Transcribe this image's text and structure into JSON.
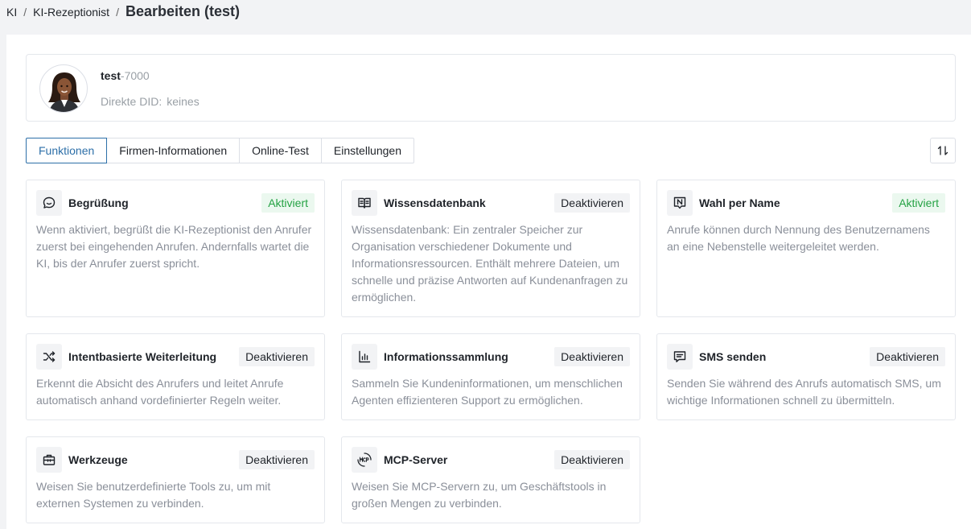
{
  "breadcrumb": {
    "items": [
      "KI",
      "KI-Rezeptionist"
    ],
    "separator": "/",
    "current": "Bearbeiten (test)"
  },
  "agent": {
    "name": "test",
    "extension": "-7000",
    "did_label": "Direkte DID:",
    "did_value": "keines"
  },
  "tabs": [
    {
      "label": "Funktionen",
      "active": true
    },
    {
      "label": "Firmen-Informationen",
      "active": false
    },
    {
      "label": "Online-Test",
      "active": false
    },
    {
      "label": "Einstellungen",
      "active": false
    }
  ],
  "colors": {
    "accent": "#2d6fa8",
    "active_green": "#25a244",
    "active_green_bg": "#ebf8ef"
  },
  "cards": [
    {
      "icon": "chat-bubble-icon",
      "title": "Begrüßung",
      "button": "Aktiviert",
      "active": true,
      "desc": "Wenn aktiviert, begrüßt die KI-Rezeptionist den Anrufer zuerst bei eingehenden Anrufen. Andernfalls wartet die KI, bis der Anrufer zuerst spricht."
    },
    {
      "icon": "book-icon",
      "title": "Wissensdatenbank",
      "button": "Deaktivieren",
      "active": false,
      "desc": "Wissensdatenbank: Ein zentraler Speicher zur Organisation verschiedener Dokumente und Informationsressourcen. Enthält mehrere Dateien, um schnelle und präzise Antworten auf Kundenanfragen zu ermöglichen."
    },
    {
      "icon": "name-badge-icon",
      "title": "Wahl per Name",
      "button": "Aktiviert",
      "active": true,
      "desc": "Anrufe können durch Nennung des Benutzernamens an eine Nebenstelle weitergeleitet werden."
    },
    {
      "icon": "shuffle-icon",
      "title": "Intentbasierte Weiterleitung",
      "button": "Deaktivieren",
      "active": false,
      "desc": "Erkennt die Absicht des Anrufers und leitet Anrufe automatisch anhand vordefinierter Regeln weiter."
    },
    {
      "icon": "bar-chart-icon",
      "title": "Informationssammlung",
      "button": "Deaktivieren",
      "active": false,
      "desc": "Sammeln Sie Kundeninformationen, um menschlichen Agenten effizienteren Support zu ermöglichen."
    },
    {
      "icon": "message-icon",
      "title": "SMS senden",
      "button": "Deaktivieren",
      "active": false,
      "desc": "Senden Sie während des Anrufs automatisch SMS, um wichtige Informationen schnell zu übermitteln."
    },
    {
      "icon": "toolbox-icon",
      "title": "Werkzeuge",
      "button": "Deaktivieren",
      "active": false,
      "desc": "Weisen Sie benutzerdefinierte Tools zu, um mit externen Systemen zu verbinden."
    },
    {
      "icon": "mcp-icon",
      "title": "MCP-Server",
      "button": "Deaktivieren",
      "active": false,
      "desc": "Weisen Sie MCP-Servern zu, um Geschäftstools in großen Mengen zu verbinden."
    }
  ]
}
